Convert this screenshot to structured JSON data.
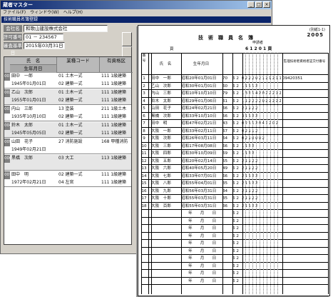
{
  "app": {
    "title": "蔵者マスター",
    "menu": [
      "ファイル(F)",
      "ウィンドウ(W)",
      "ヘルプ(H)"
    ],
    "subwindow_title": "技術職員名簿登録",
    "fields": [
      {
        "label": "会社名",
        "value": "和歌山建設株式会社"
      },
      {
        "label": "許可番号",
        "value": "01 － 234567"
      },
      {
        "label": "審査基準日",
        "value": "2015年03月31日"
      }
    ],
    "grid": {
      "header_top": [
        "氏　名",
        "業種コード",
        "有資格区"
      ],
      "header_bottom": [
        "生年月日",
        "",
        ""
      ],
      "rows": [
        {
          "no": "001",
          "name": "田中　一郎",
          "dob": "1945年01月01日",
          "codes": [
            "01 土木一式",
            "02 建築一式"
          ],
          "qual": [
            "111 1級建築",
            "111 1級建築"
          ]
        },
        {
          "no": "002",
          "name": "乙山　次郎",
          "dob": "1955年01月01日",
          "codes": [
            "01 土木一式",
            "02 建築一式"
          ],
          "qual": [
            "111 1級建築",
            "111 1級建築"
          ]
        },
        {
          "no": "003",
          "name": "内山　三郎",
          "dob": "1935年10月10日",
          "codes": [
            "13 塗装",
            "02 建築一式"
          ],
          "qual": [
            "211 1級土木",
            "111 1級建築"
          ]
        },
        {
          "no": "004",
          "name": "鈴木　太郎",
          "dob": "1945年05月05日",
          "codes": [
            "01 土木一式",
            "02 建築一式"
          ],
          "qual": [
            "111 1級建築",
            "111 1級建築"
          ]
        },
        {
          "no": "005",
          "name": "山田　花子",
          "dob": "1949年02月21日",
          "codes": [
            "27 消防施設",
            ""
          ],
          "qual": [
            "168 甲種消防",
            ""
          ]
        },
        {
          "no": "006",
          "name": "黒橋　次郎",
          "dob": "",
          "codes": [
            "03 大工",
            ""
          ],
          "qual": [
            "113 1級建築",
            ""
          ]
        },
        {
          "no": "007",
          "name": "田中　明",
          "dob": "1972年02月21日",
          "codes": [
            "02 建築一式",
            "04 左官"
          ],
          "qual": [
            "111 1級建築",
            "111 1級建築"
          ]
        }
      ]
    }
  },
  "report": {
    "corner_note": "(別紙1-1)",
    "year_label": "2005",
    "title": "技　術　職　員　名　簿",
    "page_label": "頁",
    "applicant_label": "申請者",
    "period_label": "6 1 2 0 1 頁",
    "col_no": "番号",
    "col_name": "氏　名",
    "col_birth": "生年月日",
    "col_license": "監理技術者資格者証交付番号",
    "rows": [
      {
        "no": "1",
        "name": "田中　一郎",
        "birth": "昭和20年01月01日",
        "a": "70",
        "b": "6 2",
        "c": "0 2 2 2 0 2 1 2 1 2 1 1",
        "lic": "09420351"
      },
      {
        "no": "2",
        "name": "乙山　次郎",
        "birth": "昭和30年01月01日",
        "a": "60",
        "b": "6 2",
        "c": "1 1 1 1 2",
        "lic": ""
      },
      {
        "no": "3",
        "name": "内山　三郎",
        "birth": "昭和10年10月10日",
        "a": "79",
        "b": "6 2",
        "c": "1 3 2 1 4 2 0 2 2 2 1 2",
        "lic": ""
      },
      {
        "no": "4",
        "name": "鈴木　太郎",
        "birth": "昭和29年01月06日",
        "a": "61",
        "b": "6 2",
        "c": "1 1 2 2 2 2 0 2 2 2 2 2",
        "lic": ""
      },
      {
        "no": "5",
        "name": "山田　花子",
        "birth": "昭和24年02月21日",
        "a": "66",
        "b": "6 2",
        "c": "2 1 1 2 2",
        "lic": ""
      },
      {
        "no": "6",
        "name": "黒橋　次郎",
        "birth": "昭和33年10月10日",
        "a": "56",
        "b": "6 2",
        "c": "3 1 1 2 2",
        "lic": ""
      },
      {
        "no": "7",
        "name": "田中　明",
        "birth": "昭和47年02月21日",
        "a": "43",
        "b": "6 2",
        "c": "0 2 1 1 2 0 4 1 2 0 2",
        "lic": ""
      },
      {
        "no": "8",
        "name": "大阪　一郎",
        "birth": "昭和33年02月11日",
        "a": "67",
        "b": "6 2",
        "c": "0 2 1 1 2",
        "lic": ""
      },
      {
        "no": "9",
        "name": "大阪　次郎",
        "birth": "昭和26年03月11日",
        "a": "64",
        "b": "6 2",
        "c": "0 2 1 0 0 0 2",
        "lic": ""
      },
      {
        "no": "10",
        "name": "大阪　三郎",
        "birth": "昭和17年08月08日",
        "a": "66",
        "b": "6 2",
        "c": "1 1 2 2",
        "lic": ""
      },
      {
        "no": "11",
        "name": "大阪　四郎",
        "birth": "昭和30年10月09日",
        "a": "69",
        "b": "6 2",
        "c": "1 1 2 2",
        "lic": ""
      },
      {
        "no": "12",
        "name": "大阪　五郎",
        "birth": "昭和20年02月14日",
        "a": "55",
        "b": "6 2",
        "c": "2 1 1 2 2",
        "lic": ""
      },
      {
        "no": "13",
        "name": "大阪　六郎",
        "birth": "昭和40年05月20日",
        "a": "49",
        "b": "6 2",
        "c": "2 1 1 2 2",
        "lic": ""
      },
      {
        "no": "14",
        "name": "大阪　七郎",
        "birth": "昭和33年07月01日",
        "a": "66",
        "b": "6 2",
        "c": "2 1 1 2 2",
        "lic": ""
      },
      {
        "no": "15",
        "name": "大阪　八郎",
        "birth": "昭和55年04月01日",
        "a": "35",
        "b": "6 2",
        "c": "2 1 1 2 2",
        "lic": ""
      },
      {
        "no": "16",
        "name": "大阪　九郎",
        "birth": "昭和56年03月31日",
        "a": "34",
        "b": "6 2",
        "c": "2 1 1 2 2",
        "lic": ""
      },
      {
        "no": "17",
        "name": "大阪　十郎",
        "birth": "昭和55年03月31日",
        "a": "35",
        "b": "6 2",
        "c": "2 1 1 2 2",
        "lic": ""
      },
      {
        "no": "18",
        "name": "大阪　百郎",
        "birth": "昭和55年03月31日",
        "a": "36",
        "b": "6 2",
        "c": "2 1 1 2 2",
        "lic": ""
      }
    ],
    "blank_birth": "年　　月　　日",
    "blank_b": "6 2",
    "blank_rows": 10
  }
}
